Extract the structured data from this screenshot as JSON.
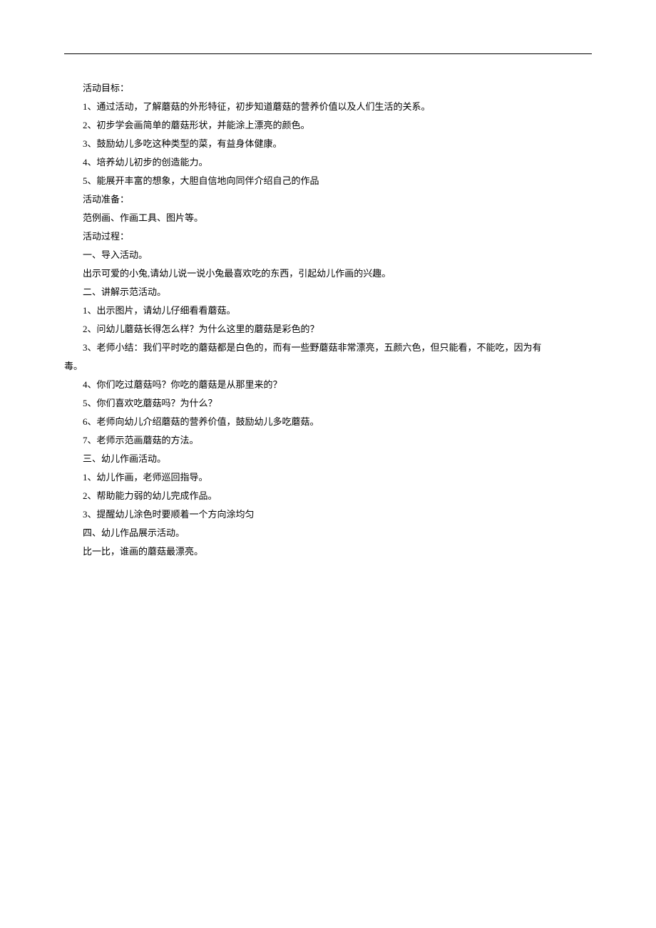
{
  "lines": [
    {
      "indent": true,
      "text": " 活动目标："
    },
    {
      "indent": true,
      "text": "1、通过活动，了解蘑菇的外形特征，初步知道蘑菇的营养价值以及人们生活的关系。"
    },
    {
      "indent": true,
      "text": "2、初步学会画简单的蘑菇形状，并能涂上漂亮的颜色。"
    },
    {
      "indent": true,
      "text": "3、鼓励幼儿多吃这种类型的菜，有益身体健康。"
    },
    {
      "indent": true,
      "text": "4、培养幼儿初步的创造能力。"
    },
    {
      "indent": true,
      "text": "5、能展开丰富的想象，大胆自信地向同伴介绍自己的作品"
    },
    {
      "indent": true,
      "text": "活动准备："
    },
    {
      "indent": true,
      "text": "范例画、作画工具、图片等。"
    },
    {
      "indent": true,
      "text": "活动过程："
    },
    {
      "indent": true,
      "text": "一、导入活动。"
    },
    {
      "indent": true,
      "text": "出示可爱的小兔,请幼儿说一说小兔最喜欢吃的东西，引起幼儿作画的兴趣。"
    },
    {
      "indent": true,
      "text": "二、讲解示范活动。"
    },
    {
      "indent": true,
      "text": "1、出示图片，请幼儿仔细看看蘑菇。"
    },
    {
      "indent": true,
      "text": "2、问幼儿蘑菇长得怎么样？为什么这里的蘑菇是彩色的？"
    },
    {
      "indent": true,
      "text": "3、老师小结：我们平时吃的蘑菇都是白色的，而有一些野蘑菇非常漂亮，五颜六色，但只能看，不能吃，因为有"
    },
    {
      "indent": false,
      "text": "毒。"
    },
    {
      "indent": true,
      "text": "4、你们吃过蘑菇吗？你吃的蘑菇是从那里来的？"
    },
    {
      "indent": true,
      "text": "5、你们喜欢吃蘑菇吗？为什么？"
    },
    {
      "indent": true,
      "text": "6、老师向幼儿介绍蘑菇的营养价值，鼓励幼儿多吃蘑菇。"
    },
    {
      "indent": true,
      "text": "7、老师示范画蘑菇的方法。"
    },
    {
      "indent": true,
      "text": "三、幼儿作画活动。"
    },
    {
      "indent": true,
      "text": "1、幼儿作画，老师巡回指导。"
    },
    {
      "indent": true,
      "text": "2、帮助能力弱的幼儿完成作品。"
    },
    {
      "indent": true,
      "text": "3、提醒幼儿涂色时要顺着一个方向涂均匀"
    },
    {
      "indent": true,
      "text": "四、幼儿作品展示活动。"
    },
    {
      "indent": true,
      "text": "比一比，谁画的蘑菇最漂亮。"
    }
  ]
}
